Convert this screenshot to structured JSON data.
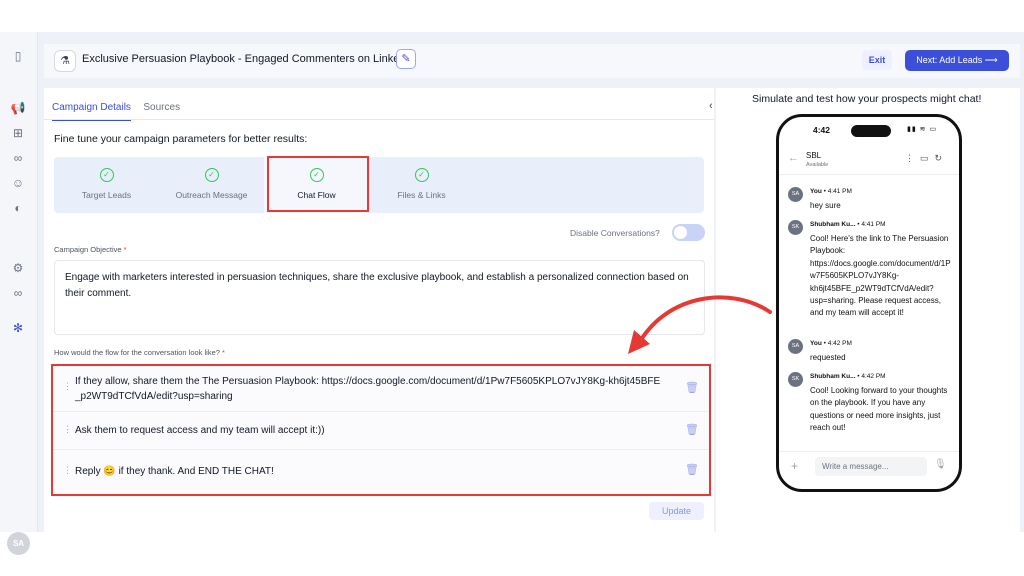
{
  "header": {
    "title": "Exclusive Persuasion Playbook - Engaged Commenters on LinkedIn",
    "exit_label": "Exit",
    "next_label": "Next: Add Leads ⟶"
  },
  "rail": {
    "avatar": "SA"
  },
  "tabs": [
    {
      "label": "Campaign Details",
      "active": true
    },
    {
      "label": "Sources",
      "active": false
    }
  ],
  "intro": "Fine tune your campaign parameters for better results:",
  "steps": [
    {
      "label": "Target Leads",
      "done": true
    },
    {
      "label": "Outreach Message",
      "done": true
    },
    {
      "label": "Chat Flow",
      "done": true,
      "active": true
    },
    {
      "label": "Files & Links",
      "done": true
    }
  ],
  "disable_conversations": {
    "label": "Disable Conversations?",
    "on": false
  },
  "objective": {
    "label": "Campaign Objective",
    "required_mark": "*",
    "value": "Engage with marketers interested in persuasion techniques, share the exclusive playbook, and establish a personalized connection based on their comment."
  },
  "flow": {
    "label": "How would the flow for the conversation look like?",
    "required_mark": "*",
    "items": [
      "If they allow, share them the The Persuasion Playbook: https://docs.google.com/document/d/1Pw7F5605KPLO7vJY8Kg-kh6jt45BFE_p2WT9dTCfVdA/edit?usp=sharing",
      "Ask them to request access and my team will accept it:))",
      "Reply 😊 if they thank. And END THE CHAT!"
    ]
  },
  "update_label": "Update",
  "simulator": {
    "title": "Simulate and test how your prospects might chat!",
    "phone_time": "4:42",
    "contact_name": "SBL",
    "contact_status": "Available",
    "messages": [
      {
        "avatar": "SA",
        "sender": "You",
        "time": "4:41 PM",
        "text": "hey sure"
      },
      {
        "avatar": "SK",
        "sender": "Shubham Ku...",
        "time": "4:41 PM",
        "text": "Cool! Here's the link to The Persuasion Playbook: https://docs.google.com/document/d/1Pw7F5605KPLO7vJY8Kg-kh6jt45BFE_p2WT9dTCfVdA/edit?usp=sharing. Please request access, and my team will accept it!"
      },
      {
        "avatar": "SA",
        "sender": "You",
        "time": "4:42 PM",
        "text": "requested"
      },
      {
        "avatar": "SK",
        "sender": "Shubham Ku...",
        "time": "4:42 PM",
        "text": "Cool! Looking forward to your thoughts on the playbook. If you have any questions or need more insights, just reach out!"
      }
    ],
    "composer_placeholder": "Write a message..."
  },
  "colors": {
    "accent": "#3b4fd8",
    "highlight": "#e53935",
    "success": "#34c759"
  }
}
